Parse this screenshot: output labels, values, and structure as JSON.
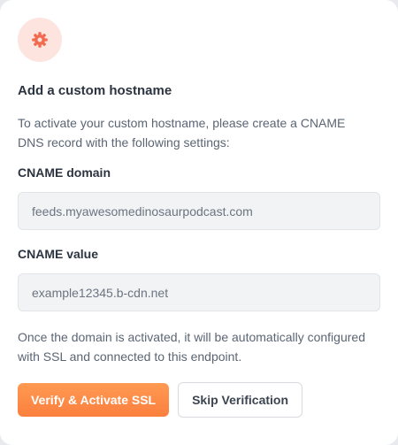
{
  "dialog": {
    "icon": "gear-icon",
    "title": "Add a custom hostname",
    "description": "To activate your custom hostname, please create a CNAME DNS record with the following settings:",
    "cname_domain_label": "CNAME domain",
    "cname_domain_value": "feeds.myawesomedinosaurpodcast.com",
    "cname_value_label": "CNAME value",
    "cname_value_value": "example12345.b-cdn.net",
    "footer_note": "Once the domain is activated, it will be automatically configured with SSL and connected to this endpoint.",
    "primary_button_label": "Verify & Activate SSL",
    "secondary_button_label": "Skip Verification"
  },
  "colors": {
    "accent": "#fb7f3e",
    "icon_bg": "#fde4df",
    "icon_fg": "#f26a4f"
  }
}
